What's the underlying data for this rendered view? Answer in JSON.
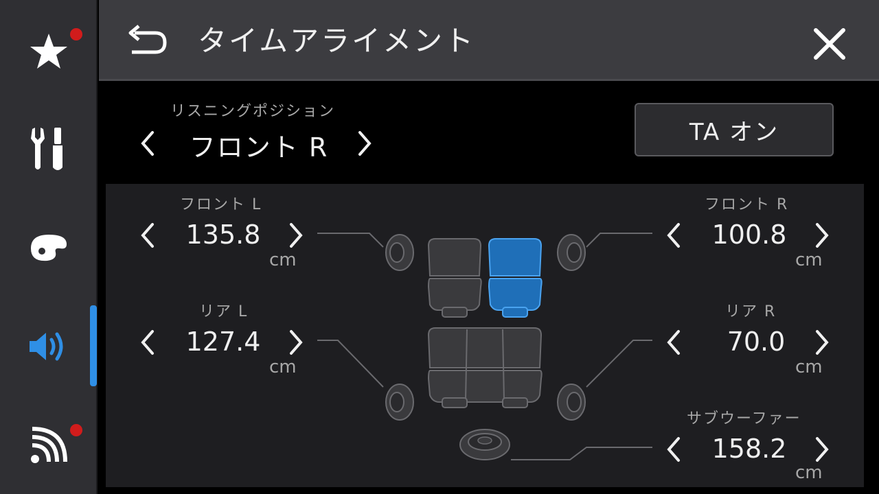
{
  "sidebar": {
    "items": [
      {
        "icon": "star-icon",
        "badge": true
      },
      {
        "icon": "tools-icon",
        "badge": false
      },
      {
        "icon": "palette-icon",
        "badge": false
      },
      {
        "icon": "speaker-icon",
        "badge": false,
        "active": true
      },
      {
        "icon": "wireless-icon",
        "badge": true
      }
    ],
    "accent_color": "#2f8fe6",
    "badge_color": "#d11c1c"
  },
  "header": {
    "title": "タイムアライメント",
    "back_icon": "back-arrow-icon",
    "close_icon": "close-icon"
  },
  "listening_position": {
    "label": "リスニングポジション",
    "value": "フロント R",
    "prev_icon": "chevron-left-icon",
    "next_icon": "chevron-right-icon"
  },
  "ta_button": {
    "label": "TA オン"
  },
  "channels": {
    "front_l": {
      "label": "フロント L",
      "value": "135.8",
      "unit": "cm"
    },
    "front_r": {
      "label": "フロント R",
      "value": "100.8",
      "unit": "cm"
    },
    "rear_l": {
      "label": "リア L",
      "value": "127.4",
      "unit": "cm"
    },
    "rear_r": {
      "label": "リア R",
      "value": "70.0",
      "unit": "cm"
    },
    "subwoofer": {
      "label": "サブウーファー",
      "value": "158.2",
      "unit": "cm"
    }
  },
  "selected_seat": "front-right",
  "colors": {
    "selected_seat": "#2f8fe6",
    "seat": "#4a4a4e"
  }
}
